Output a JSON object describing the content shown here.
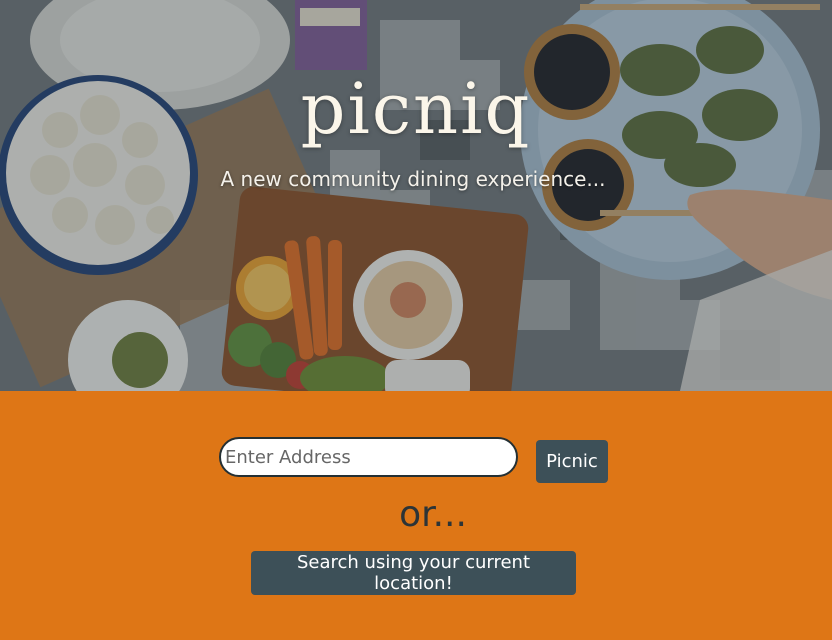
{
  "hero": {
    "title": "picniq",
    "subtitle": "A new community dining experience..."
  },
  "search": {
    "placeholder": "Enter Address",
    "value": "",
    "submit_label": "Picnic"
  },
  "divider_text": "or...",
  "location_button_label": "Search using your current location!",
  "colors": {
    "panel_background": "#de7616",
    "button_background": "#3d5058",
    "title_color": "#fbf6ea"
  }
}
